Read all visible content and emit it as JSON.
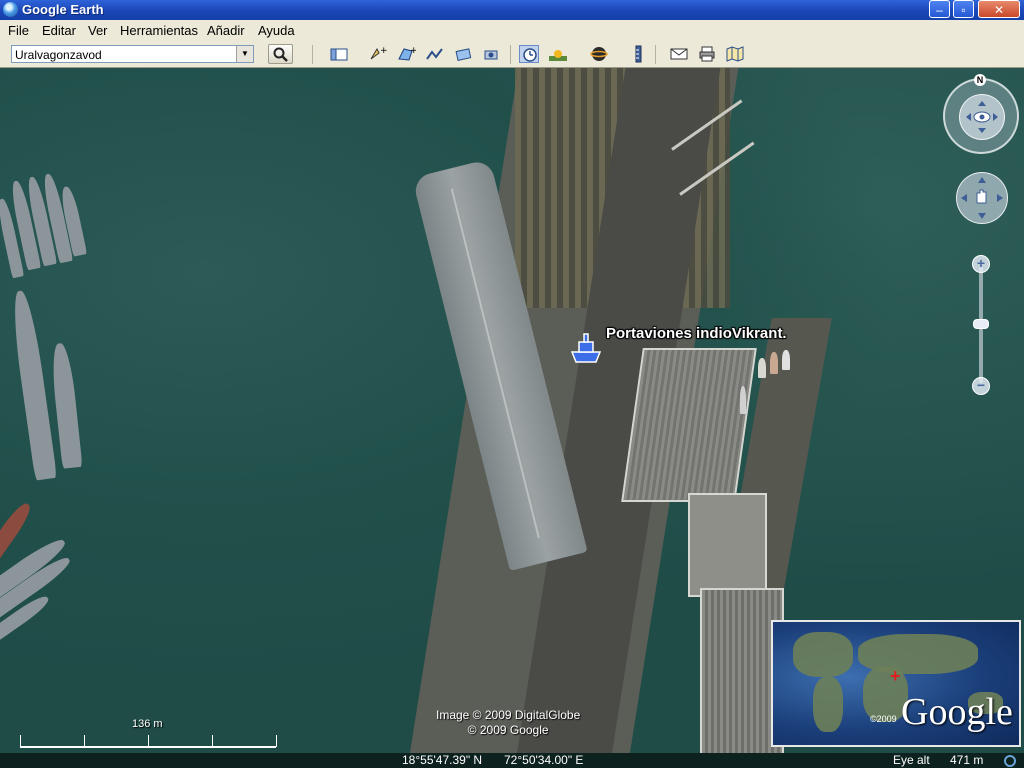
{
  "window": {
    "title": "Google Earth",
    "minimize": "–",
    "maximize": "▫",
    "close": "✕"
  },
  "menu": {
    "items": [
      "File",
      "Editar",
      "Ver",
      "Herramientas",
      "Añadir",
      "Ayuda"
    ]
  },
  "toolbar": {
    "search_value": "Uralvagonzavod",
    "dropdown_arrow": "▼"
  },
  "placemark": {
    "label": "Portaviones indioVikrant."
  },
  "navigation": {
    "north_label": "N",
    "zoom_in": "+",
    "zoom_out": "−"
  },
  "overview": {
    "copyright": "©2009",
    "logo": "Google"
  },
  "attribution": {
    "line1": "Image © 2009 DigitalGlobe",
    "line2": "© 2009 Google"
  },
  "scale": {
    "label": "136 m"
  },
  "status": {
    "latitude": "18°55'47.39\" N",
    "longitude": "72°50'34.00\" E",
    "eye_alt_label": "Eye alt",
    "eye_alt_value": "471 m"
  }
}
